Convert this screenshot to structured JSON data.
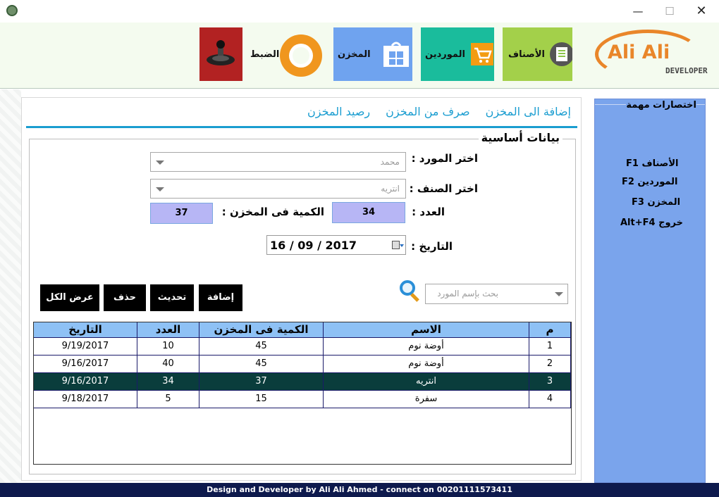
{
  "ribbon": {
    "settings": "الضبط",
    "store": "المخزن",
    "suppliers": "الموردين",
    "items": "الأصناف"
  },
  "logo": {
    "name": "Ali Ali",
    "sub": "DEVELOPER"
  },
  "tabs": [
    "إضافة الى المخزن",
    "صرف من المخزن",
    "رصيد المخزن"
  ],
  "form": {
    "group_title": "بيانات أساسية",
    "supplier_label": "اختر المورد :",
    "supplier_value": "محمد",
    "item_label": "اختر الصنف :",
    "item_value": "انتريه",
    "count_label": "العدد :",
    "count_value": "34",
    "stock_label": "الكمية فى المخزن :",
    "stock_value": "37",
    "date_label": "التاريخ :",
    "date_value": "16 / 09 / 2017"
  },
  "buttons": {
    "add": "إضافة",
    "update": "تحديث",
    "delete": "حذف",
    "show_all": "عرض الكل"
  },
  "search": {
    "placeholder": "بحث بإسم المورد"
  },
  "table": {
    "headers": {
      "num": "م",
      "name": "الاسم",
      "stock": "الكمية فى المخزن",
      "count": "العدد",
      "date": "التاريخ"
    },
    "rows": [
      {
        "num": "1",
        "name": "أوضة نوم",
        "stock": "45",
        "count": "10",
        "date": "9/19/2017"
      },
      {
        "num": "2",
        "name": "أوضة نوم",
        "stock": "45",
        "count": "40",
        "date": "9/16/2017"
      },
      {
        "num": "3",
        "name": "انتريه",
        "stock": "37",
        "count": "34",
        "date": "9/16/2017"
      },
      {
        "num": "4",
        "name": "سفرة",
        "stock": "15",
        "count": "5",
        "date": "9/18/2017"
      }
    ]
  },
  "shortcuts": {
    "title": "اختصارات مهمة",
    "items": "الأصناف  F1",
    "suppliers": "الموردين  F2",
    "store": "المخزن F3",
    "exit": "خروج  Alt+F4"
  },
  "footer": "Design and Developer by Ali Ali Ahmed - connect on 00201111573411",
  "colors": {
    "accent": "#1a9dd0",
    "selected_row": "#0a3d3c",
    "footer": "#0e1a4d",
    "shortcut_panel": "#7aa4ec"
  }
}
